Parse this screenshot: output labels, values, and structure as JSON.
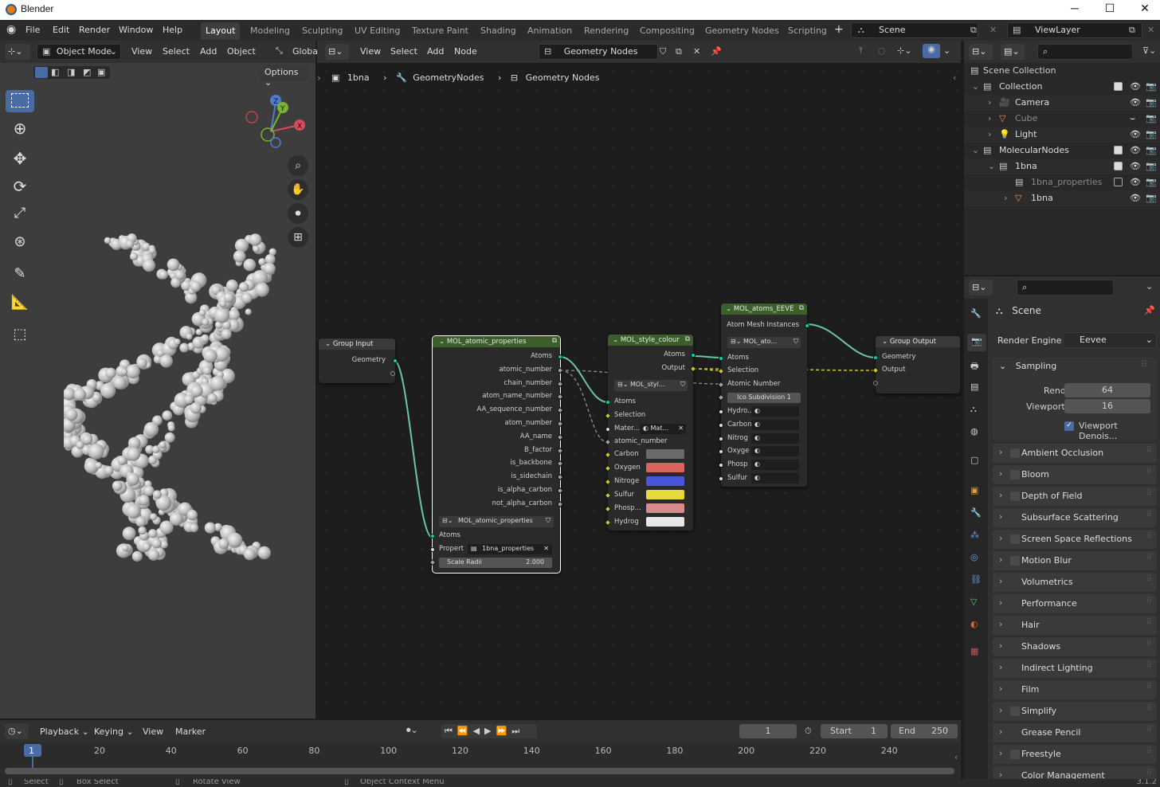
{
  "window": {
    "title": "Blender"
  },
  "menus": [
    "File",
    "Edit",
    "Render",
    "Window",
    "Help"
  ],
  "workspace_tabs": [
    "Layout",
    "Modeling",
    "Sculpting",
    "UV Editing",
    "Texture Paint",
    "Shading",
    "Animation",
    "Rendering",
    "Compositing",
    "Geometry Nodes",
    "Scripting"
  ],
  "active_tab": "Layout",
  "scene_name": "Scene",
  "view_layer": "ViewLayer",
  "viewport": {
    "mode": "Object Mode",
    "menus": [
      "View",
      "Select",
      "Add",
      "Object"
    ],
    "transform": "Globa",
    "options": "Options",
    "gizmo": {
      "z": "Z",
      "y": "Y",
      "x": "X"
    }
  },
  "node_editor": {
    "menus": [
      "View",
      "Select",
      "Add",
      "Node"
    ],
    "tree_name": "Geometry Nodes",
    "breadcrumb": [
      "1bna",
      "GeometryNodes",
      "Geometry Nodes"
    ],
    "nodes": {
      "group_input": {
        "title": "Group Input",
        "outputs": [
          "Geometry"
        ]
      },
      "atomic_props": {
        "title": "MOL_atomic_properties",
        "outputs": [
          "Atoms",
          "atomic_number",
          "chain_number",
          "atom_name_number",
          "AA_sequence_number",
          "atom_number",
          "AA_name",
          "B_factor",
          "is_backbone",
          "is_sidechain",
          "is_alpha_carbon",
          "not_alpha_carbon"
        ],
        "group": "MOL_atomic_properties",
        "inputs": [
          "Atoms"
        ],
        "property_label": "Propert",
        "property_value": "1bna_properties",
        "scale_label": "Scale Radii",
        "scale_value": "2.000"
      },
      "style_colour": {
        "title": "MOL_style_colour",
        "outputs": [
          "Atoms",
          "Output"
        ],
        "group": "MOL_styl...",
        "inputs": [
          "Atoms",
          "Selection"
        ],
        "material_label": "Mater...",
        "material_value": "Mat...",
        "atomic_number": "atomic_number",
        "colors": [
          {
            "label": "Carbon",
            "color": "#6a6a6a"
          },
          {
            "label": "Oxygen",
            "color": "#d9625c"
          },
          {
            "label": "Nitroge",
            "color": "#4a56d9"
          },
          {
            "label": "Sulfur",
            "color": "#e6d93a"
          },
          {
            "label": "Phosp...",
            "color": "#d98a8a"
          },
          {
            "label": "Hydrog",
            "color": "#e8e8e8"
          }
        ]
      },
      "atoms_eevee": {
        "title": "MOL_atoms_EEVE",
        "outputs": [
          "Atom Mesh Instances"
        ],
        "group": "MOL_ato...",
        "inputs": [
          "Atoms",
          "Selection",
          "Atomic Number"
        ],
        "subdivision": "Ico Subdivision  1",
        "elements": [
          "Hydro...",
          "Carbon",
          "Nitrog",
          "Oxyge",
          "Phosp",
          "Sulfur"
        ]
      },
      "group_output": {
        "title": "Group Output",
        "inputs": [
          "Geometry",
          "Output"
        ]
      }
    }
  },
  "outliner": {
    "root": "Scene Collection",
    "items": [
      {
        "name": "Collection",
        "depth": 0
      },
      {
        "name": "Camera",
        "depth": 1
      },
      {
        "name": "Cube",
        "depth": 1
      },
      {
        "name": "Light",
        "depth": 1
      },
      {
        "name": "MolecularNodes",
        "depth": 0
      },
      {
        "name": "1bna",
        "depth": 1
      },
      {
        "name": "1bna_properties",
        "depth": 2
      },
      {
        "name": "1bna",
        "depth": 2
      }
    ]
  },
  "properties": {
    "context": "Scene",
    "render_engine_label": "Render Engine",
    "render_engine": "Eevee",
    "sampling": {
      "title": "Sampling",
      "render_label": "Render",
      "render": "64",
      "viewport_label": "Viewport",
      "viewport": "16",
      "denoise": "Viewport Denois..."
    },
    "sections": [
      "Ambient Occlusion",
      "Bloom",
      "Depth of Field",
      "Subsurface Scattering",
      "Screen Space Reflections",
      "Motion Blur",
      "Volumetrics",
      "Performance",
      "Hair",
      "Shadows",
      "Indirect Lighting",
      "Film",
      "Simplify",
      "Grease Pencil",
      "Freestyle",
      "Color Management"
    ],
    "sections_with_checkbox": [
      true,
      true,
      true,
      false,
      true,
      true,
      false,
      false,
      false,
      false,
      false,
      false,
      true,
      false,
      true,
      false
    ]
  },
  "timeline": {
    "menus": [
      "Playback",
      "Keying",
      "View",
      "Marker"
    ],
    "current_frame": "1",
    "start_label": "Start",
    "start": "1",
    "end_label": "End",
    "end": "250",
    "ticks": [
      "1",
      "20",
      "40",
      "60",
      "80",
      "100",
      "120",
      "140",
      "160",
      "180",
      "200",
      "220",
      "240"
    ]
  },
  "statusbar": [
    "Select",
    "Box Select",
    "Rotate View",
    "Object Context Menu"
  ],
  "version": "3.1.2"
}
